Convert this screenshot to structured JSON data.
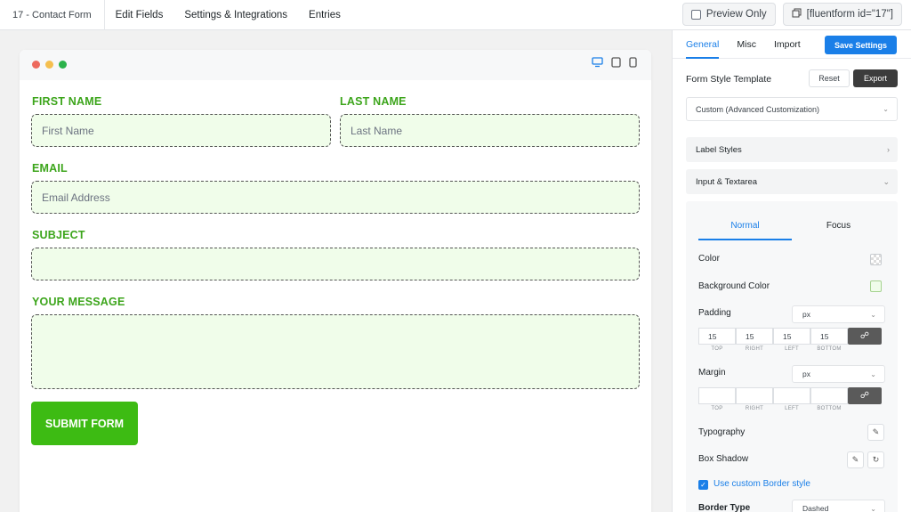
{
  "topbar": {
    "form_title": "17 - Contact Form",
    "nav": [
      "Edit Fields",
      "Settings & Integrations",
      "Entries"
    ],
    "preview_label": "Preview Only",
    "shortcode": "[fluentform id=\"17\"]"
  },
  "form": {
    "first_name_label": "FIRST NAME",
    "first_name_placeholder": "First Name",
    "last_name_label": "LAST NAME",
    "last_name_placeholder": "Last Name",
    "email_label": "EMAIL",
    "email_placeholder": "Email Address",
    "subject_label": "SUBJECT",
    "message_label": "YOUR MESSAGE",
    "submit_label": "SUBMIT FORM"
  },
  "panel": {
    "tabs": [
      "General",
      "Misc",
      "Import"
    ],
    "save_label": "Save Settings",
    "template_label": "Form Style Template",
    "reset_label": "Reset",
    "export_label": "Export",
    "template_value": "Custom (Advanced Customization)",
    "label_styles": "Label Styles",
    "input_textarea": "Input & Textarea",
    "state_tabs": [
      "Normal",
      "Focus"
    ],
    "color_label": "Color",
    "bg_color_label": "Background Color",
    "padding_label": "Padding",
    "padding_unit": "px",
    "padding_values": [
      "15",
      "15",
      "15",
      "15"
    ],
    "side_captions": [
      "TOP",
      "RIGHT",
      "LEFT",
      "BOTTOM"
    ],
    "margin_label": "Margin",
    "margin_unit": "px",
    "typography_label": "Typography",
    "box_shadow_label": "Box Shadow",
    "custom_border_label": "Use custom Border style",
    "border_type_label": "Border Type",
    "border_type_value": "Dashed"
  },
  "colors": {
    "accent": "#1a7fe8",
    "label_green": "#3ca51b",
    "submit_green": "#3dbb13",
    "input_bg": "#f0fdea"
  }
}
